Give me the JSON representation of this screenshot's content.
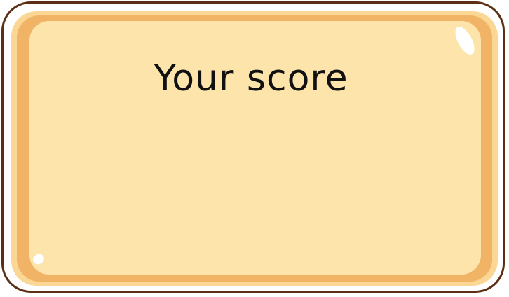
{
  "score_panel": {
    "title": "Your score"
  },
  "colors": {
    "outline": "#5a2f14",
    "outer_gold": "#fbd795",
    "orange_band": "#f1b466",
    "panel_fill": "#fde4aa",
    "text": "#111111"
  }
}
